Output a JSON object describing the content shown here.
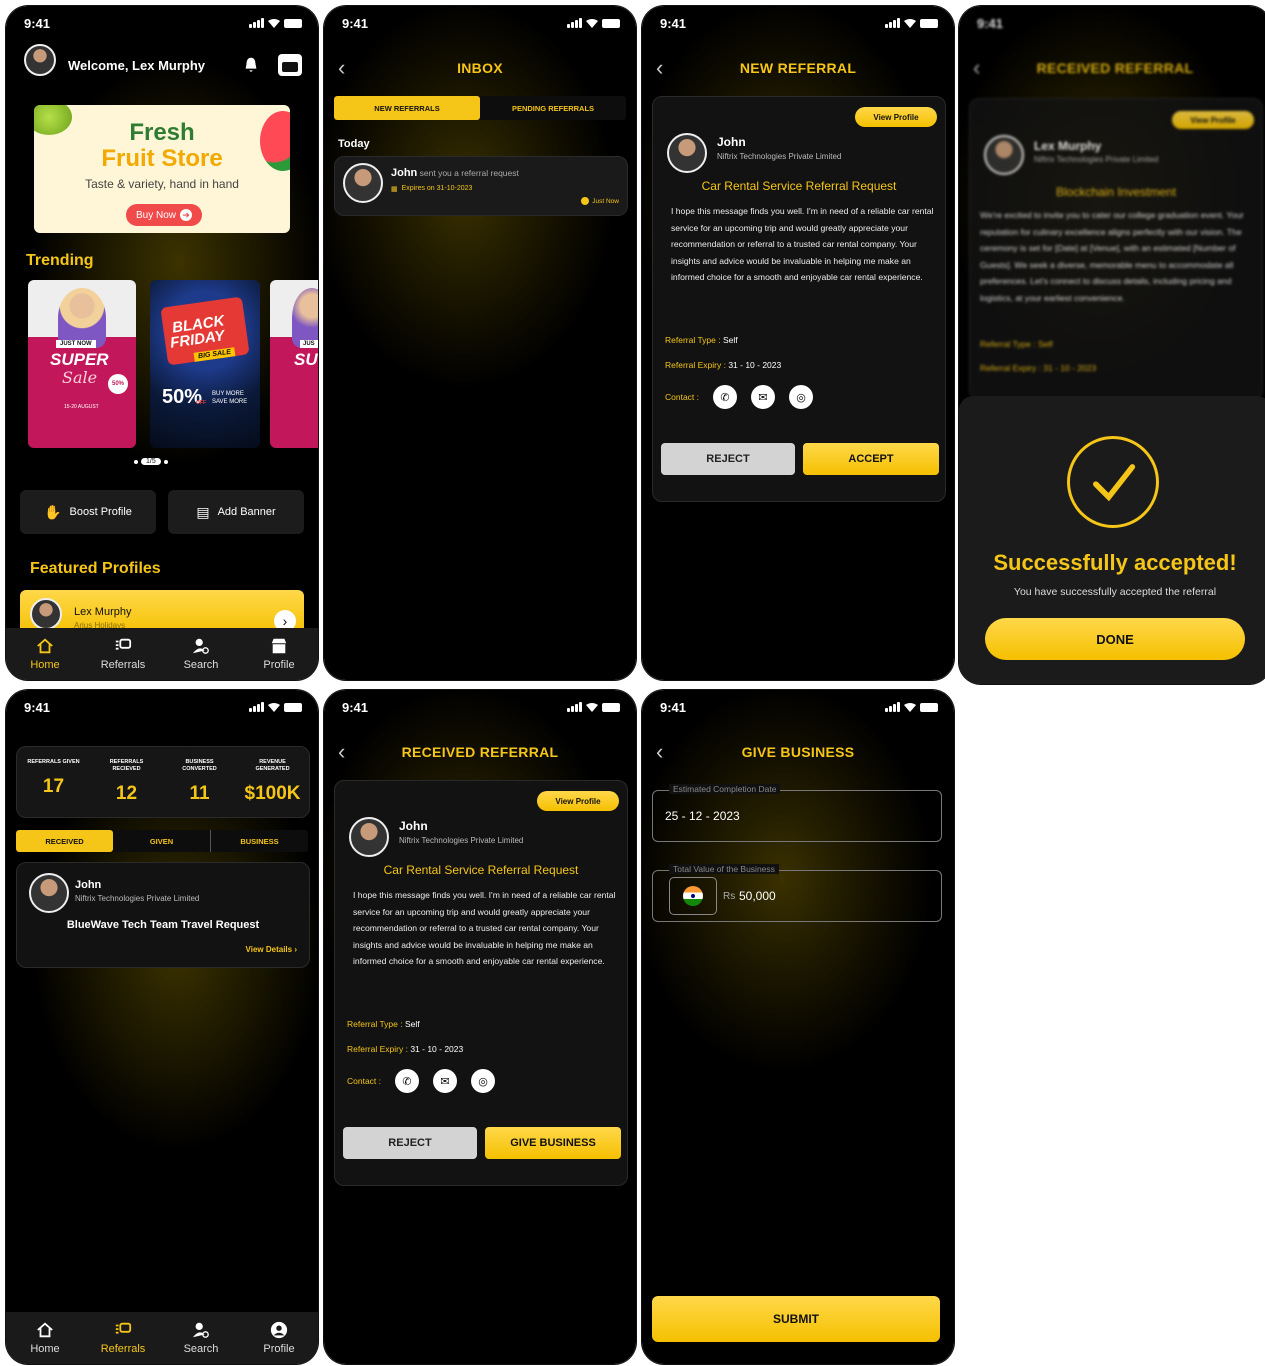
{
  "status": {
    "time": "9:41"
  },
  "home": {
    "welcome": "Welcome, Lex Murphy",
    "banner": {
      "title1": "Fresh",
      "title2": "Fruit Store",
      "tagline": "Taste & variety, hand in hand",
      "cta": "Buy Now"
    },
    "trending_label": "Trending",
    "promo1": {
      "tag": "JUST NOW",
      "big": "SUPER",
      "script": "Sale",
      "pct": "50%",
      "info": "15-20 AUGUST"
    },
    "promo2": {
      "l1": "BLACK",
      "l2": "FRIDAY",
      "sub": "BIG SALE",
      "pct": "50%",
      "off": "OFF",
      "more": "BUY MORE SAVE MORE"
    },
    "promo3": {
      "tag": "JUS",
      "big": "SU"
    },
    "pager": "1/5",
    "boost": "Boost Profile",
    "add_banner": "Add Banner",
    "featured_label": "Featured Profiles",
    "featured": {
      "name": "Lex Murphy",
      "company": "Arius Holidays"
    }
  },
  "nav": {
    "home": "Home",
    "referrals": "Referrals",
    "search": "Search",
    "profile": "Profile"
  },
  "inbox": {
    "title": "INBOX",
    "tab_new": "NEW REFERRALS",
    "tab_pending": "PENDING REFERRALS",
    "today": "Today",
    "item_name": "John",
    "item_text": "sent you a referral request",
    "item_expires": "Expires on 31-10-2023",
    "item_time": "Just Now"
  },
  "referral": {
    "new_title": "NEW REFERRAL",
    "received_title": "RECEIVED REFERRAL",
    "view_profile": "View Profile",
    "name": "John",
    "company": "Niftrix Technologies Private Limited",
    "subject": "Car Rental Service Referral Request",
    "body": "I hope this message finds you well. I'm in need of a reliable car rental service for an upcoming trip and would greatly appreciate your recommendation or referral to a trusted car rental company. Your insights and advice would be invaluable in helping me make an informed choice for a smooth and enjoyable car rental experience.",
    "type_label": "Referral Type :",
    "type_value": "Self",
    "expiry_label": "Referral Expiry :",
    "expiry_value": "31 - 10 - 2023",
    "contact_label": "Contact :",
    "reject": "REJECT",
    "accept": "ACCEPT",
    "give_business": "GIVE BUSINESS"
  },
  "blurred": {
    "title": "RECEIVED REFERRAL",
    "view_profile": "View Profile",
    "name": "Lex Murphy",
    "company": "Niftrix Technologies Private Limited",
    "subject": "Blockchain Investment",
    "body": "We're excited to invite you to cater our college graduation event. Your reputation for culinary excellence aligns perfectly with our vision. The ceremony is set for [Date] at [Venue], with an estimated [Number of Guests]. We seek a diverse, memorable menu to accommodate all preferences. Let's connect to discuss details, including pricing and logistics, at your earliest convenience.",
    "type": "Referral Type : Self",
    "expiry": "Referral Expiry : 31 - 10 - 2023"
  },
  "success": {
    "title": "Successfully accepted!",
    "subtitle": "You have successfully accepted the referral",
    "done": "DONE"
  },
  "stats": {
    "given_label": "REFERRALS GIVEN",
    "given": "17",
    "received_label": "REFERRALS RECIEVED",
    "received": "12",
    "converted_label": "BUSINESS CONVERTED",
    "converted": "11",
    "revenue_label": "REVENUE GENERATED",
    "revenue": "$100K",
    "tab_received": "RECEIVED",
    "tab_given": "GIVEN",
    "tab_business": "BUSINESS",
    "item_name": "John",
    "item_company": "Niftrix Technologies Private Limited",
    "item_title": "BlueWave Tech Team Travel Request",
    "view_details": "View Details"
  },
  "give_business": {
    "title": "GIVE BUSINESS",
    "date_label": "Estimated Completion Date",
    "date_value": "25 - 12 - 2023",
    "value_label": "Total Value of the Business",
    "currency": "Rs",
    "value": "50,000",
    "submit": "SUBMIT"
  }
}
